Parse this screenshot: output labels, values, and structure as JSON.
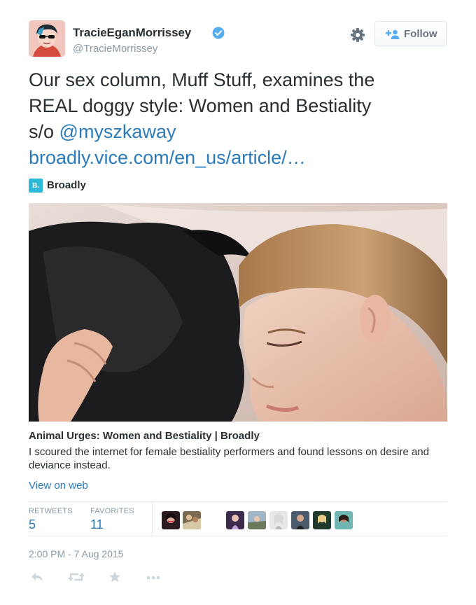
{
  "user": {
    "display_name": "TracieEganMorrissey",
    "handle": "@TracieMorrissey",
    "verified": true
  },
  "header": {
    "follow_label": "Follow",
    "settings_icon": "gear-icon",
    "follow_icon": "add-user-icon"
  },
  "tweet": {
    "line1": "Our sex column, Muff Stuff, examines the",
    "line2": "REAL doggy style: Women and Bestiality",
    "line3_prefix": "s/o ",
    "mention": "@myszkaway",
    "url": "broadly.vice.com/en_us/article/…"
  },
  "source": {
    "logo_text": "B.",
    "name": "Broadly"
  },
  "card": {
    "title": "Animal Urges: Women and Bestiality | Broadly",
    "description": "I scoured the internet for female bestiality performers and found lessons on desire and deviance instead.",
    "view_on_web": "View on web"
  },
  "stats": {
    "retweets_label": "RETWEETS",
    "retweets": "5",
    "favorites_label": "FAVORITES",
    "favorites": "11"
  },
  "timestamp": "2:00 PM - 7 Aug 2015",
  "actions": [
    "reply-icon",
    "retweet-icon",
    "favorite-icon",
    "more-icon"
  ],
  "colors": {
    "link": "#2b7bb9",
    "text": "#292f33",
    "muted": "#8899a6",
    "verified": "#55acee",
    "broadly": "#2bbbd8"
  }
}
